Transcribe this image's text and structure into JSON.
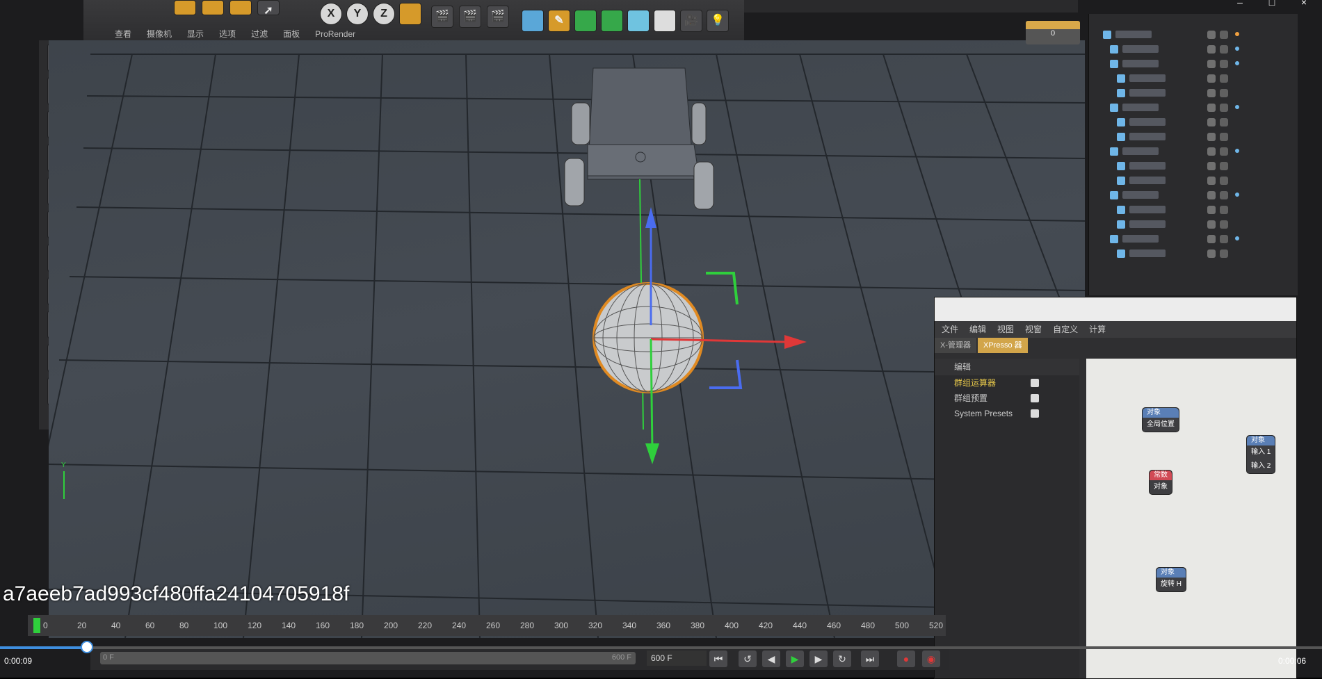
{
  "window": {
    "minimize_icon": "minimize-icon",
    "maximize_icon": "maximize-icon",
    "close_icon": "close-icon"
  },
  "toolbar": {
    "axis_x": "X",
    "axis_y": "Y",
    "axis_z": "Z"
  },
  "viewport_tabs": [
    "查看",
    "摄像机",
    "显示",
    "选项",
    "过滤",
    "面板",
    "ProRender"
  ],
  "frame_readout": "0",
  "xpresso": {
    "menu": [
      "文件",
      "编辑",
      "视图",
      "视窗",
      "自定义",
      "计算"
    ],
    "tabs": [
      "X-管理器",
      "XPresso 器"
    ],
    "left_header": "编辑",
    "items": [
      "群组运算器",
      "群组预置",
      "System Presets"
    ],
    "nodes": [
      {
        "title": "对象",
        "ports": [
          "全局位置"
        ]
      },
      {
        "title": "对象",
        "ports": [
          "输入 1",
          "输入 2"
        ]
      },
      {
        "title": "常数",
        "ports": [
          "对象"
        ]
      },
      {
        "title": "对象",
        "ports": [
          "旋转 H"
        ]
      }
    ]
  },
  "timeline": {
    "ticks": [
      "0",
      "20",
      "40",
      "60",
      "80",
      "100",
      "120",
      "140",
      "160",
      "180",
      "200",
      "220",
      "240",
      "260",
      "280",
      "300",
      "320",
      "340",
      "360",
      "380",
      "400",
      "420",
      "440",
      "460",
      "480",
      "500",
      "520"
    ],
    "start_field": "0 F",
    "end_field": "600 F",
    "range_end": "600 F"
  },
  "video": {
    "id": "a7aeeb7ad993cf480ffa24104705918f",
    "elapsed": "0:00:09",
    "remaining": "0:00:06",
    "progress_fraction": 0.066
  }
}
